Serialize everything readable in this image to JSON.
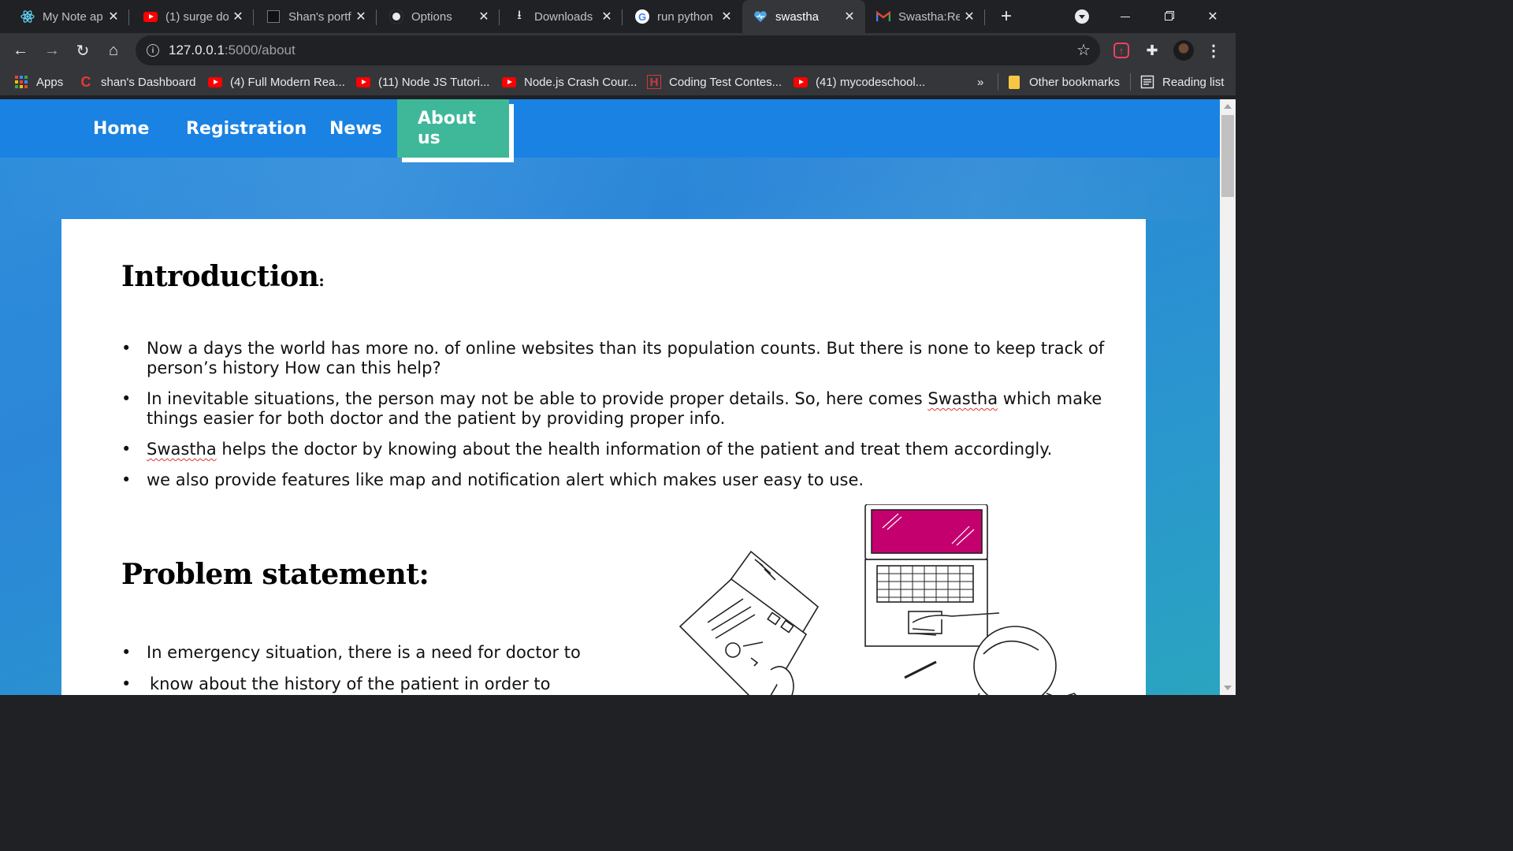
{
  "browser": {
    "tabs": [
      {
        "title": "My Note ap",
        "icon": "react-icon"
      },
      {
        "title": "(1) surge do",
        "icon": "youtube-icon"
      },
      {
        "title": "Shan's portf",
        "icon": "portfolio-icon"
      },
      {
        "title": "Options",
        "icon": "github-icon"
      },
      {
        "title": "Downloads",
        "icon": "download-icon"
      },
      {
        "title": "run python",
        "icon": "google-icon"
      },
      {
        "title": "swastha",
        "icon": "heart-icon",
        "active": true
      },
      {
        "title": "Swastha:Re",
        "icon": "gmail-icon"
      }
    ],
    "address": {
      "host": "127.0.0.1",
      "path": ":5000/about"
    },
    "bookmarks": [
      {
        "label": "Apps",
        "icon": "apps-grid-icon"
      },
      {
        "label": "shan's Dashboard",
        "icon": "codechef-icon"
      },
      {
        "label": "(4) Full Modern Rea...",
        "icon": "youtube-icon"
      },
      {
        "label": "(11) Node JS Tutori...",
        "icon": "youtube-icon"
      },
      {
        "label": "Node.js Crash Cour...",
        "icon": "youtube-icon"
      },
      {
        "label": "Coding Test Contes...",
        "icon": "hackerearth-icon"
      },
      {
        "label": "(41) mycodeschool...",
        "icon": "youtube-icon"
      }
    ],
    "overflow": "»",
    "other_bookmarks": "Other bookmarks",
    "reading_list": "Reading list"
  },
  "site": {
    "nav": [
      {
        "label": "Home"
      },
      {
        "label": "Registration"
      },
      {
        "label": "News"
      },
      {
        "label": "About us",
        "active": true
      }
    ],
    "intro_heading": "Introduction",
    "intro_colon": ":",
    "intro_bullets": [
      {
        "pre": "Now a days the world has more no. of online websites than its population counts. But there is none to keep track of person’s history How can this help?",
        "mark": "",
        "post": ""
      },
      {
        "pre": "In inevitable situations, the person may not be able to provide proper details. So, here comes ",
        "mark": "Swastha",
        "post": " which make things easier for both doctor and the patient  by providing proper info."
      },
      {
        "pre": "",
        "mark": "Swastha",
        "post": " helps the doctor by knowing about the health information of the patient and treat them accordingly."
      },
      {
        "pre": "we also provide features like map and notification alert which makes user easy to use.",
        "mark": "",
        "post": ""
      }
    ],
    "problem_heading": "Problem statement:",
    "problem_line1": "In emergency situation, there is a need for  doctor to",
    "problem_line2": "know about the history of the patient in order to"
  },
  "colors": {
    "nav_bg": "#1a82e2",
    "nav_active": "#3fb89a",
    "laptop_screen": "#c4006e"
  }
}
